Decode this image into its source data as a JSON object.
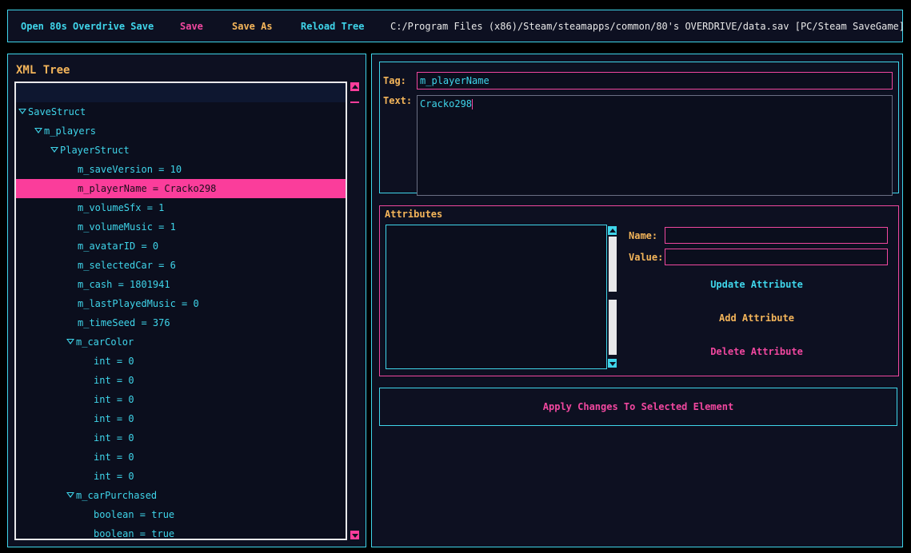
{
  "toolbar": {
    "open_label": "Open 80s Overdrive Save",
    "save_label": "Save",
    "save_as_label": "Save As",
    "reload_label": "Reload Tree",
    "file_path": "C:/Program Files (x86)/Steam/steamapps/common/80's OVERDRIVE/data.sav [PC/Steam SaveGame]"
  },
  "tree": {
    "title": "XML Tree",
    "rows": [
      {
        "label": "SaveStruct",
        "expanded": true
      },
      {
        "label": "m_players",
        "expanded": true
      },
      {
        "label": "PlayerStruct",
        "expanded": true
      },
      {
        "label": "m_saveVersion = 10"
      },
      {
        "label": "m_playerName = Cracko298",
        "selected": true
      },
      {
        "label": "m_volumeSfx = 1"
      },
      {
        "label": "m_volumeMusic = 1"
      },
      {
        "label": "m_avatarID = 0"
      },
      {
        "label": "m_selectedCar = 6"
      },
      {
        "label": "m_cash = 1801941"
      },
      {
        "label": "m_lastPlayedMusic = 0"
      },
      {
        "label": "m_timeSeed = 376"
      },
      {
        "label": "m_carColor",
        "expanded": true
      },
      {
        "label": "int = 0"
      },
      {
        "label": "int = 0"
      },
      {
        "label": "int = 0"
      },
      {
        "label": "int = 0"
      },
      {
        "label": "int = 0"
      },
      {
        "label": "int = 0"
      },
      {
        "label": "int = 0"
      },
      {
        "label": "m_carPurchased",
        "expanded": true
      },
      {
        "label": "boolean = true"
      },
      {
        "label": "boolean = true"
      }
    ]
  },
  "editor": {
    "tag_label": "Tag:",
    "tag_value": "m_playerName",
    "text_label": "Text:",
    "text_value": "Cracko298"
  },
  "attributes": {
    "title": "Attributes",
    "items": [],
    "name_label": "Name:",
    "name_value": "",
    "value_label": "Value:",
    "value_value": "",
    "update_label": "Update Attribute",
    "add_label": "Add Attribute",
    "delete_label": "Delete Attribute"
  },
  "apply_label": "Apply Changes To Selected Element",
  "colors": {
    "background": "#000000",
    "panel": "#0d1021",
    "cyan_accent": "#3fd5ea",
    "pink_accent": "#f0479f",
    "orange_accent": "#f4b55a",
    "selection": "#fb3d9b"
  }
}
